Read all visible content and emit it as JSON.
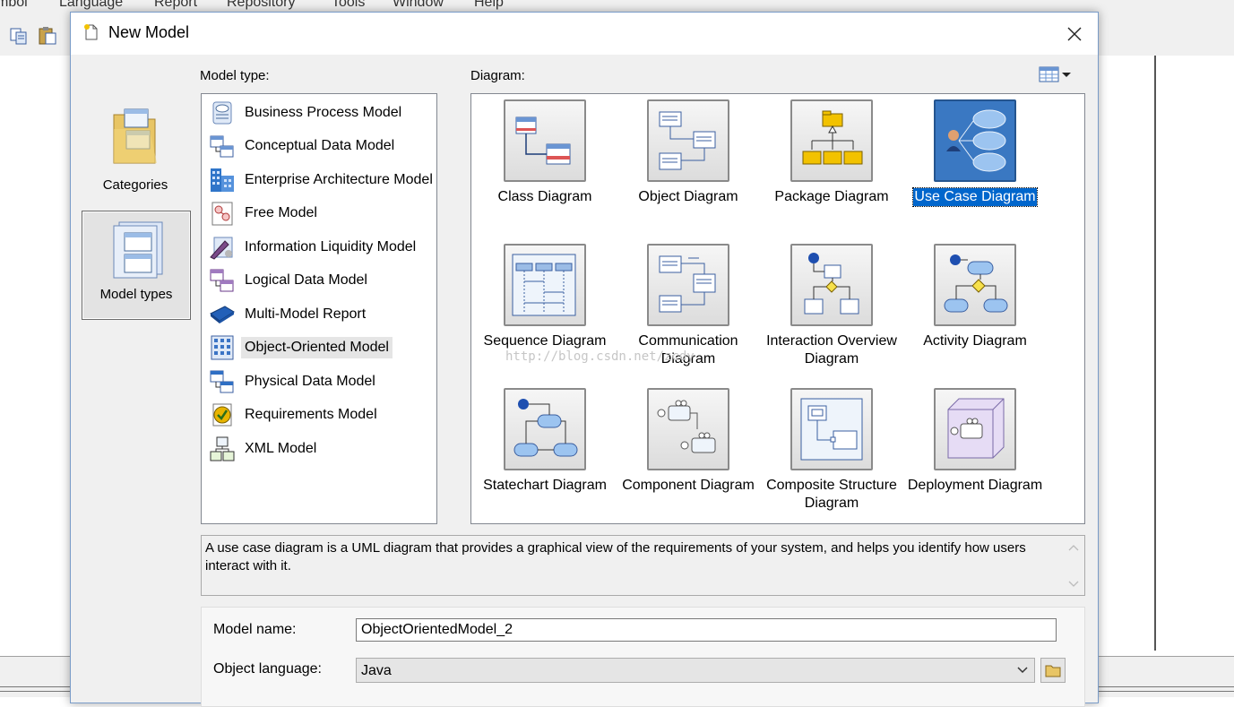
{
  "app": {
    "menu": [
      "mbol",
      "Language",
      "Report",
      "Repository",
      "Tools",
      "Window",
      "Help"
    ]
  },
  "dialog": {
    "title": "New Model",
    "rail": [
      {
        "label": "Categories",
        "icon": "categories-folder-icon",
        "selected": false
      },
      {
        "label": "Model types",
        "icon": "model-types-icon",
        "selected": true
      }
    ],
    "model_type_label": "Model type:",
    "diagram_label": "Diagram:",
    "model_types": [
      {
        "label": "Business Process Model",
        "icon": "business-process-model-icon"
      },
      {
        "label": "Conceptual Data Model",
        "icon": "conceptual-data-model-icon"
      },
      {
        "label": "Enterprise Architecture Model",
        "icon": "enterprise-architecture-model-icon"
      },
      {
        "label": "Free Model",
        "icon": "free-model-icon"
      },
      {
        "label": "Information Liquidity Model",
        "icon": "information-liquidity-model-icon"
      },
      {
        "label": "Logical Data Model",
        "icon": "logical-data-model-icon"
      },
      {
        "label": "Multi-Model Report",
        "icon": "multi-model-report-icon"
      },
      {
        "label": "Object-Oriented Model",
        "icon": "object-oriented-model-icon",
        "selected": true
      },
      {
        "label": "Physical Data Model",
        "icon": "physical-data-model-icon"
      },
      {
        "label": "Requirements Model",
        "icon": "requirements-model-icon"
      },
      {
        "label": "XML Model",
        "icon": "xml-model-icon"
      }
    ],
    "diagrams": [
      {
        "label": "Class Diagram",
        "icon": "class-diagram-icon"
      },
      {
        "label": "Object Diagram",
        "icon": "object-diagram-icon"
      },
      {
        "label": "Package Diagram",
        "icon": "package-diagram-icon"
      },
      {
        "label": "Use Case Diagram",
        "icon": "use-case-diagram-icon",
        "selected": true
      },
      {
        "label": "Sequence Diagram",
        "icon": "sequence-diagram-icon"
      },
      {
        "label": "Communication\nDiagram",
        "icon": "communication-diagram-icon"
      },
      {
        "label": "Interaction Overview\nDiagram",
        "icon": "interaction-overview-diagram-icon"
      },
      {
        "label": "Activity Diagram",
        "icon": "activity-diagram-icon"
      },
      {
        "label": "Statechart Diagram",
        "icon": "statechart-diagram-icon"
      },
      {
        "label": "Component Diagram",
        "icon": "component-diagram-icon"
      },
      {
        "label": "Composite Structure\nDiagram",
        "icon": "composite-structure-diagram-icon"
      },
      {
        "label": "Deployment Diagram",
        "icon": "deployment-diagram-icon"
      }
    ],
    "watermark": "http://blog.csdn.net/zcdy",
    "description": "A use case diagram is a UML diagram that provides a graphical view of the requirements of your system, and helps you identify how users interact with it.",
    "form": {
      "model_name_label": "Model name:",
      "model_name_value": "ObjectOrientedModel_2",
      "object_language_label": "Object language:",
      "object_language_value": "Java"
    },
    "accent_color": "#0066cc"
  }
}
